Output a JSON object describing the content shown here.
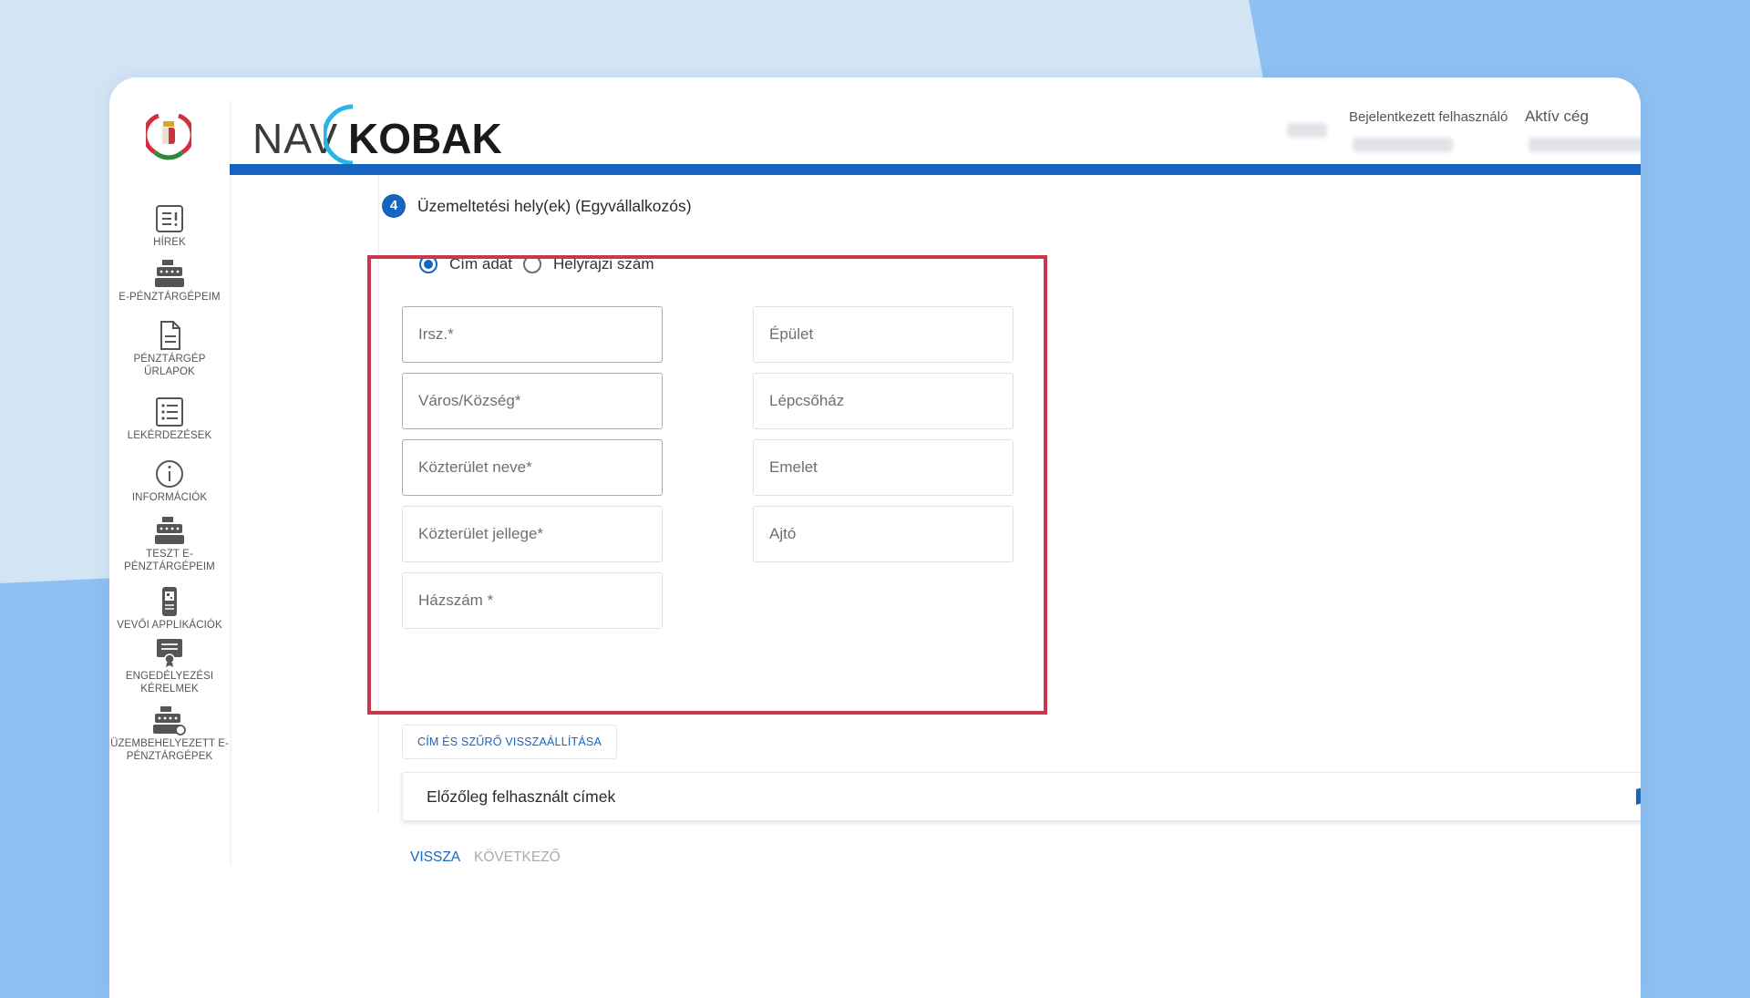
{
  "header": {
    "brand_left": "NAV",
    "brand_right": "KOBAK",
    "logged_user_label": "Bejelentkezett felhasználó",
    "active_company_label": "Aktív cég"
  },
  "sidebar": {
    "items": [
      {
        "label": "HÍREK",
        "icon": "news-icon"
      },
      {
        "label": "E-PÉNZTÁRGÉPEIM",
        "icon": "cash-register-icon"
      },
      {
        "label": "PÉNZTÁRGÉP ŰRLAPOK",
        "icon": "document-icon"
      },
      {
        "label": "LEKÉRDEZÉSEK",
        "icon": "list-icon"
      },
      {
        "label": "INFORMÁCIÓK",
        "icon": "info-icon"
      },
      {
        "label": "TESZT E-PÉNZTÁRGÉPEIM",
        "icon": "cash-register-icon"
      },
      {
        "label": "VEVŐI APPLIKÁCIÓK",
        "icon": "mobile-app-icon"
      },
      {
        "label": "ENGEDÉLYEZÉSI KÉRELMEK",
        "icon": "certificate-icon"
      },
      {
        "label": "ÜZEMBEHELYEZETT E-PÉNZTÁRGÉPEK",
        "icon": "cash-register-active-icon"
      }
    ]
  },
  "step": {
    "number": "4",
    "title": "Üzemeltetési hely(ek) (Egyvállalkozós)"
  },
  "address_type": {
    "options": [
      "Cím adat",
      "Helyrajzi szám"
    ],
    "selected": "Cím adat"
  },
  "form": {
    "left_fields": [
      "Irsz.*",
      "Város/Község*",
      "Közterület neve*",
      "Közterület jellege*",
      "Házszám *"
    ],
    "right_fields": [
      "Épület",
      "Lépcsőház",
      "Emelet",
      "Ajtó"
    ]
  },
  "reset_button": "CÍM ÉS SZŰRŐ VISSZAÁLLÍTÁSA",
  "previous_addresses": {
    "title": "Előzőleg felhasznált címek"
  },
  "navigation": {
    "back": "VISSZA",
    "next": "KÖVETKEZŐ"
  },
  "colors": {
    "primary": "#1565c0",
    "highlight": "#c8374b",
    "background": "#8fc0f4"
  }
}
